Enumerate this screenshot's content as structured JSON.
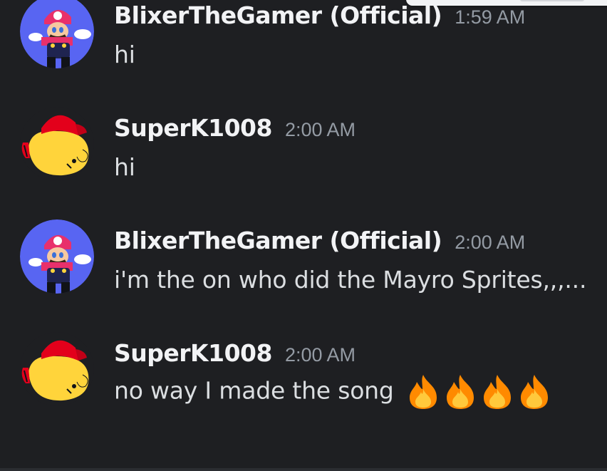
{
  "messages": [
    {
      "username": "BlixerTheGamer (Official)",
      "timestamp": "1:59 AM",
      "text": "hi",
      "avatar": "mario-avatar",
      "emojis": []
    },
    {
      "username": "SuperK1008",
      "timestamp": "2:00 AM",
      "text": "hi",
      "avatar": "yellow-cap-avatar",
      "emojis": []
    },
    {
      "username": "BlixerTheGamer (Official)",
      "timestamp": "2:00 AM",
      "text": "i'm the on who did the Mayro Sprites,,,...",
      "avatar": "mario-avatar",
      "emojis": []
    },
    {
      "username": "SuperK1008",
      "timestamp": "2:00 AM",
      "text": "no way I made the song",
      "avatar": "yellow-cap-avatar",
      "emojis": [
        "fire-emoji",
        "fire-emoji",
        "fire-emoji",
        "fire-emoji"
      ]
    }
  ],
  "colors": {
    "background": "#1e1f22",
    "username": "#f2f3f5",
    "timestamp": "#949ba4",
    "message_text": "#dbdee1",
    "avatar_blue": "#5865f2",
    "cap_red": "#e3001b",
    "face_yellow": "#ffd43b"
  }
}
